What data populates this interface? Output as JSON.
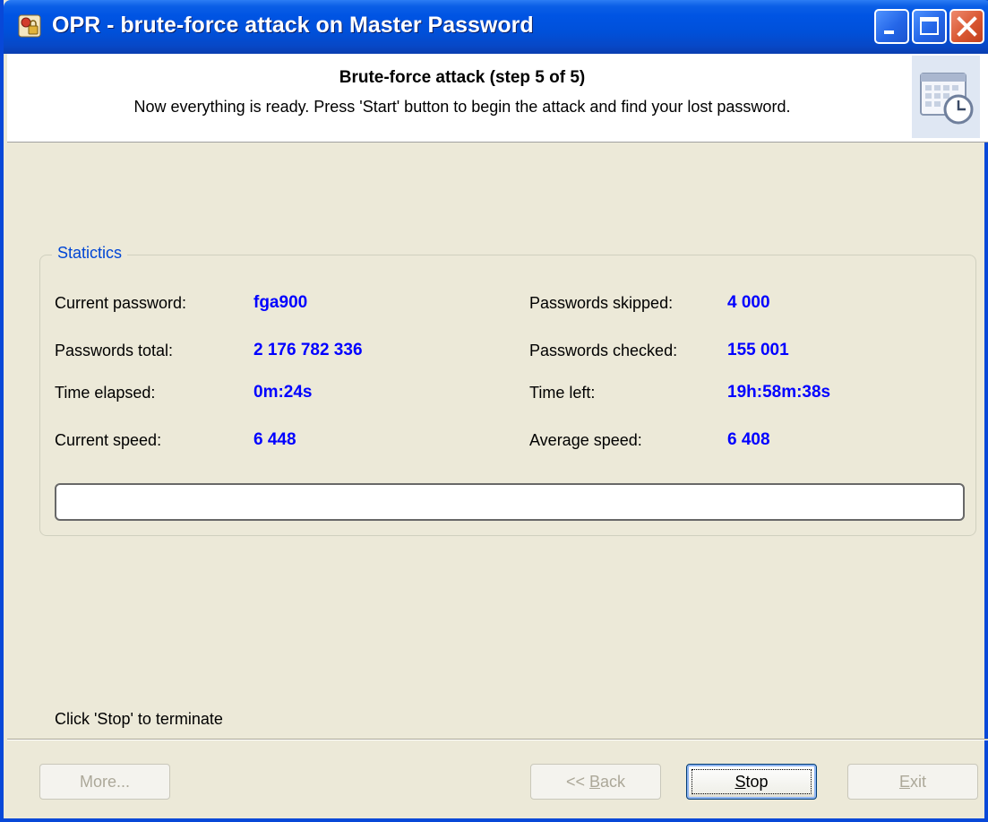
{
  "window": {
    "title": "OPR - brute-force attack on Master Password"
  },
  "header": {
    "title": "Brute-force attack (step 5 of 5)",
    "subtitle": "Now everything is ready. Press 'Start' button to begin the attack and find your lost password."
  },
  "stats": {
    "legend": "Statictics",
    "current_password_label": "Current password:",
    "current_password": "fga900",
    "passwords_total_label": "Passwords total:",
    "passwords_total": "2 176 782 336",
    "time_elapsed_label": "Time elapsed:",
    "time_elapsed": "0m:24s",
    "current_speed_label": "Current speed:",
    "current_speed": "6 448",
    "passwords_skipped_label": "Passwords skipped:",
    "passwords_skipped": "4 000",
    "passwords_checked_label": "Passwords checked:",
    "passwords_checked": "155 001",
    "time_left_label": "Time left:",
    "time_left": "19h:58m:38s",
    "average_speed_label": "Average speed:",
    "average_speed": "6 408",
    "progress_fraction": 0.0
  },
  "footer": {
    "hint": "Click 'Stop' to terminate",
    "more_label": "More...",
    "back_prefix": "<< ",
    "back_mnemonic": "B",
    "back_rest": "ack",
    "stop_mnemonic": "S",
    "stop_rest": "top",
    "exit_mnemonic": "E",
    "exit_rest": "xit"
  },
  "colors": {
    "value_text": "#0000ff",
    "legend_text": "#0046d5",
    "titlebar": "#0054e3",
    "background": "#ece9d8"
  },
  "icons": {
    "app": "key-lock-icon",
    "header": "calendar-clock-icon",
    "minimize": "minimize-icon",
    "maximize": "maximize-icon",
    "close": "close-icon"
  }
}
